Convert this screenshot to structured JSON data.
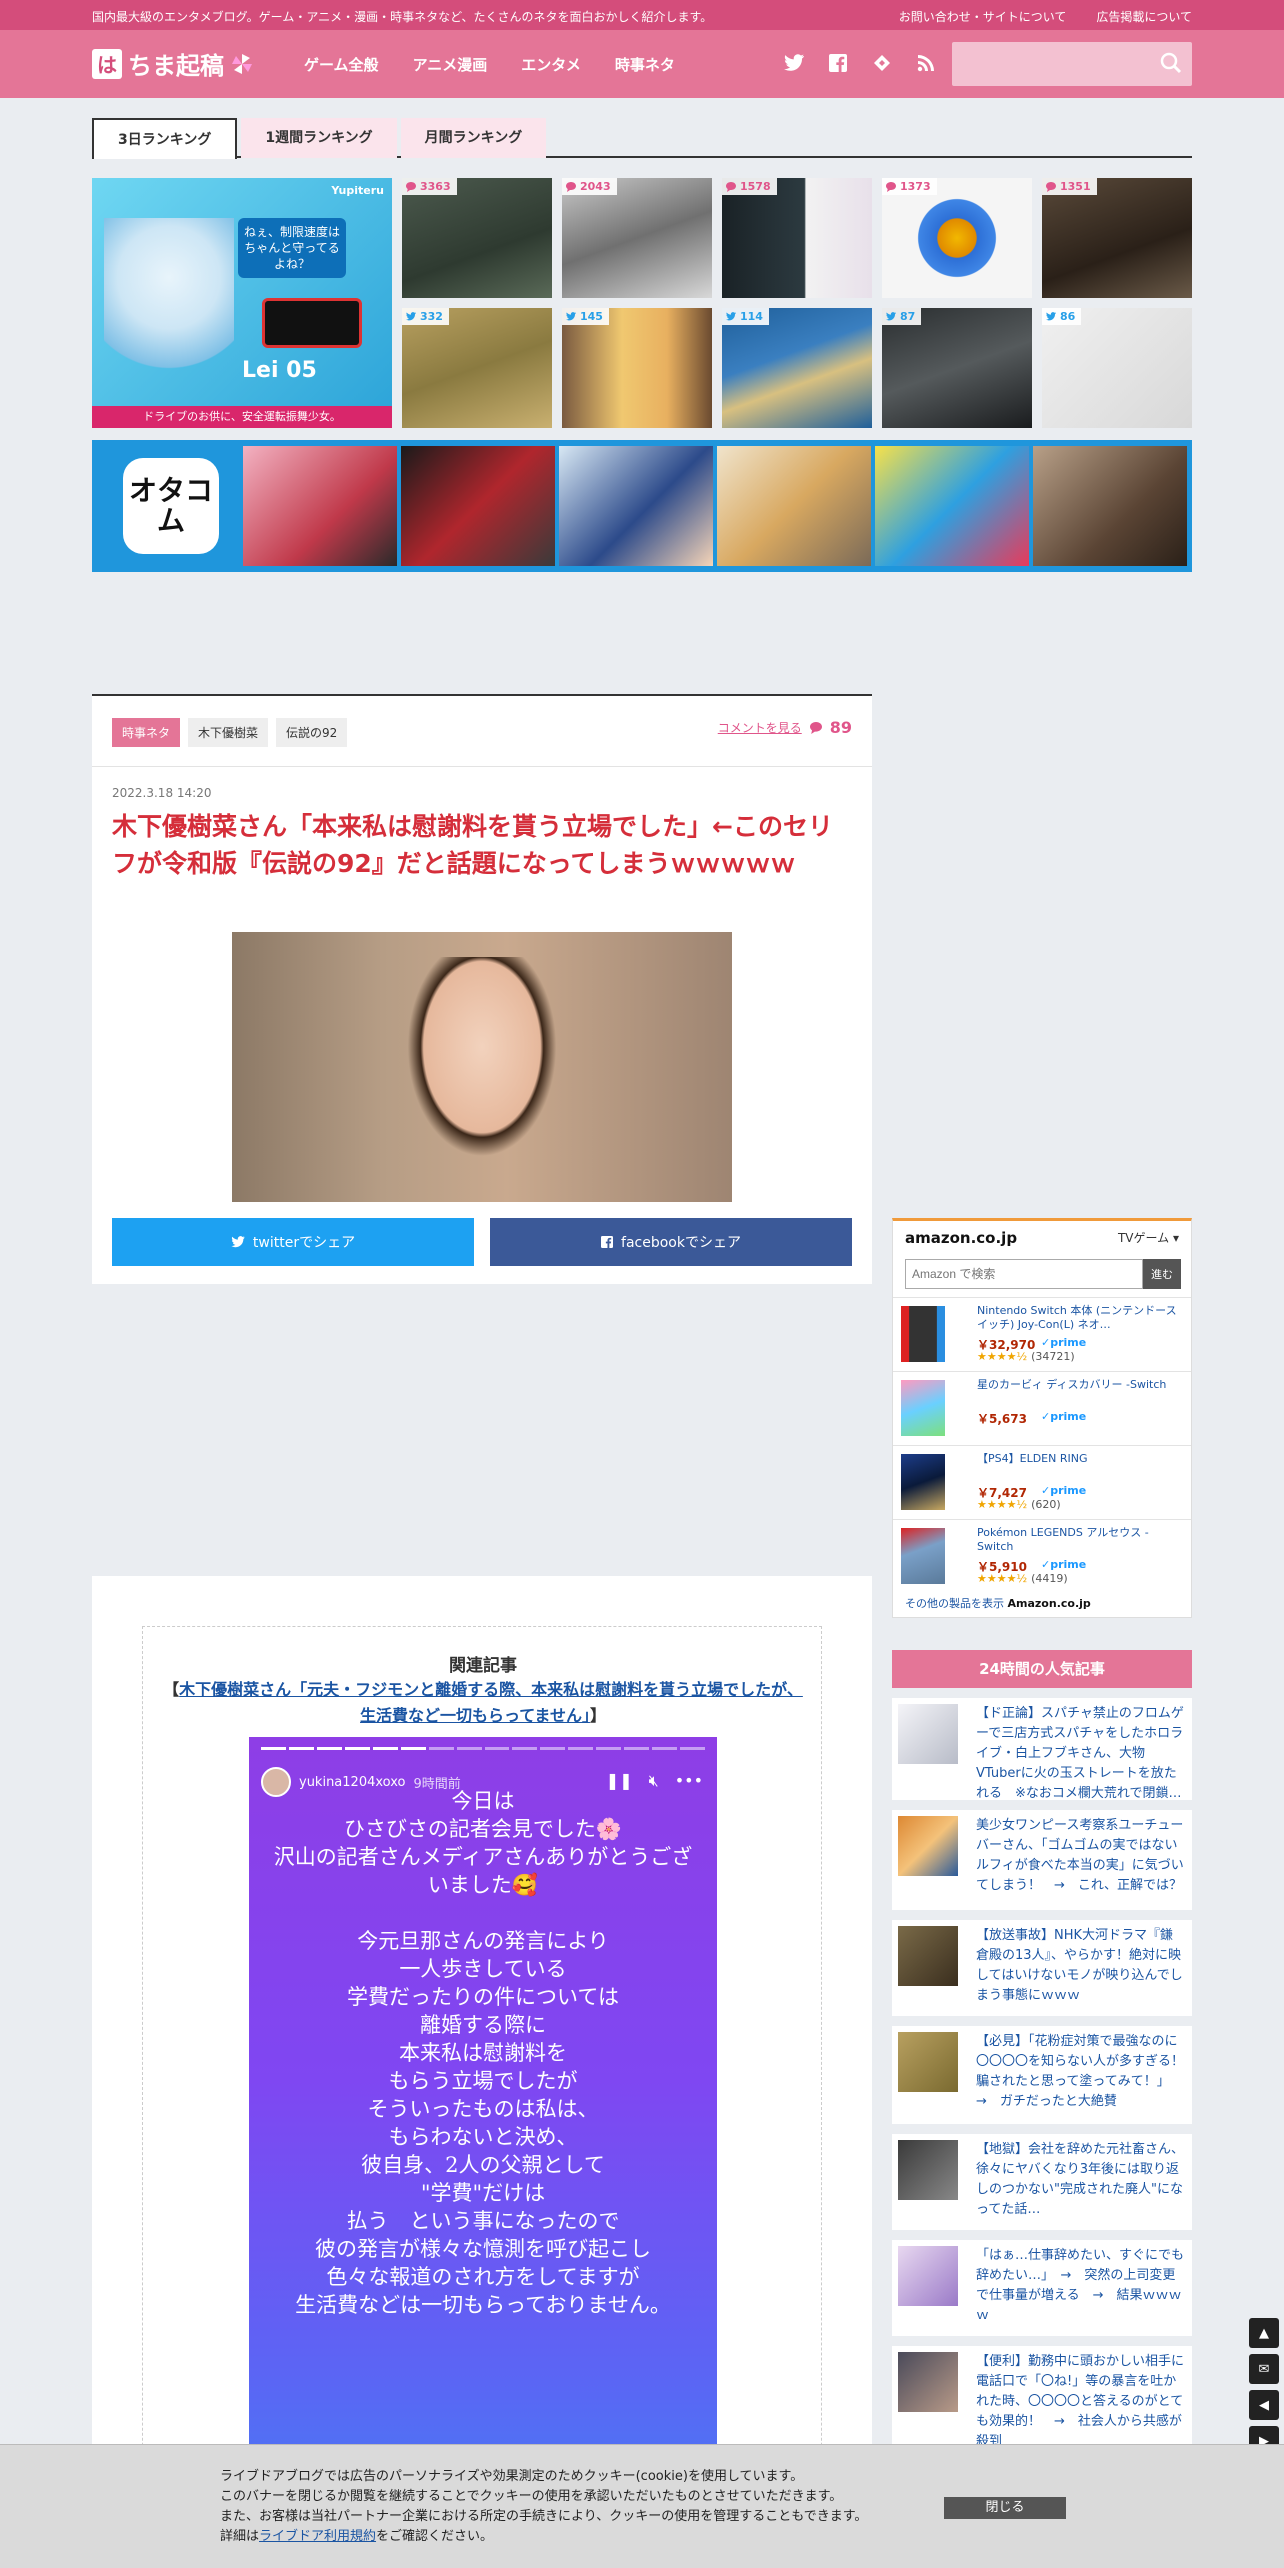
{
  "topbar": {
    "tagline": "国内最大級のエンタメブログ。ゲーム・アニメ・漫画・時事ネタなど、たくさんのネタを面白おかしく紹介します。",
    "contact": "お問い合わせ・サイトについて",
    "ads": "広告掲載について"
  },
  "header": {
    "logo_mark": "は",
    "logo_text": "ちま起稿",
    "nav": [
      "ゲーム全般",
      "アニメ漫画",
      "エンタメ",
      "時事ネタ"
    ],
    "search_placeholder": ""
  },
  "ranking_tabs": [
    "3日ランキング",
    "1週間ランキング",
    "月間ランキング"
  ],
  "ad_yupiteru": {
    "brand": "Yupiteru",
    "bubble": "ねぇ、制限速度はちゃんと守ってるよね？",
    "model": "Lei 05",
    "footer": "ドライブのお供に、安全運転振舞少女。"
  },
  "ranking_counts": [
    {
      "type": "comment",
      "count": "3363"
    },
    {
      "type": "comment",
      "count": "2043"
    },
    {
      "type": "comment",
      "count": "1578"
    },
    {
      "type": "comment",
      "count": "1373"
    },
    {
      "type": "comment",
      "count": "1351"
    },
    {
      "type": "twitter",
      "count": "332"
    },
    {
      "type": "twitter",
      "count": "145"
    },
    {
      "type": "twitter",
      "count": "114"
    },
    {
      "type": "twitter",
      "count": "87"
    },
    {
      "type": "twitter",
      "count": "86"
    }
  ],
  "ad_otacom": {
    "label": "オタコム"
  },
  "article": {
    "categories": [
      "時事ネタ",
      "木下優樹菜",
      "伝説の92"
    ],
    "comment_link": "コメントを見る",
    "comment_count": "89",
    "date": "2022.3.18 14:20",
    "title": "木下優樹菜さん「本来私は慰謝料を貰う立場でした」←このセリフが令和版『伝説の92』だと話題になってしまうｗｗｗｗｗ",
    "share_twitter": "twitterでシェア",
    "share_facebook": "facebookでシェア"
  },
  "related": {
    "heading": "関連記事",
    "open_bracket": "【",
    "link": "木下優樹菜さん「元夫・フジモンと離婚する際、本来私は慰謝料を貰う立場でしたが、生活費など一切もらってません」",
    "close_bracket": "】"
  },
  "story": {
    "username": "yukina1204xoxo",
    "time": "9時間前",
    "text": "今日は\nひさびさの記者会見でした🌸\n沢山の記者さんメディアさんありがとうございました🥰\n\n今元旦那さんの発言により\n一人歩きしている\n学費だったりの件については\n離婚する際に\n本来私は慰謝料を\nもらう立場でしたが\nそういったものは私は、\nもらわないと決め、\n彼自身、2人の父親として\n\"学費\"だけは\n払う　という事になったので\n彼の発言が様々な憶測を呼び起こし\n色々な報道のされ方をしてますが\n生活費などは一切もらっておりません。"
  },
  "amazon": {
    "logo": "amazon.co.jp",
    "category": "TVゲーム",
    "search_placeholder": "Amazon で検索",
    "go": "進む",
    "items": [
      {
        "name": "Nintendo Switch 本体 (ニンテンドースイッチ) Joy-Con(L) ネオ…",
        "price": "￥32,970",
        "prime": "✓prime",
        "stars": "★★★★½",
        "reviews": "(34721)"
      },
      {
        "name": "星のカービィ ディスカバリー -Switch",
        "price": "￥5,673",
        "prime": "✓prime",
        "stars": "",
        "reviews": ""
      },
      {
        "name": "【PS4】ELDEN RING",
        "price": "￥7,427",
        "prime": "✓prime",
        "stars": "★★★★½",
        "reviews": "(620)"
      },
      {
        "name": "Pokémon LEGENDS アルセウス -Switch",
        "price": "￥5,910",
        "prime": "✓prime",
        "stars": "★★★★½",
        "reviews": "(4419)"
      }
    ],
    "footer_text": "その他の製品を表示",
    "footer_brand": "Amazon.co.jp"
  },
  "popular": {
    "heading": "24時間の人気記事",
    "items": [
      "【ド正論】スパチャ禁止のフロムゲーで三店方式スパチャをしたホロライブ・白上フブキさん、大物VTuberに火の玉ストレートを放たれる　※なおコメ欄大荒れで閉鎖…",
      "美少女ワンピース考察系ユーチューバーさん、「ゴムゴムの実ではないルフィが食べた本当の実」に気づいてしまう！　→　これ、正解では？",
      "【放送事故】NHK大河ドラマ『鎌倉殿の13人』、やらかす！絶対に映してはいけないモノが映り込んでしまう事態にｗｗｗ",
      "【必見】「花粉症対策で最強なのに〇〇〇〇を知らない人が多すぎる！　騙されたと思って塗ってみて！」　→　ガチだったと大絶賛",
      "【地獄】会社を辞めた元社畜さん、徐々にヤバくなり3年後には取り返しのつかない\"完成された廃人\"になってた話…",
      "「はぁ…仕事辞めたい、すぐにでも辞めたい…」　→　突然の上司変更で仕事量が増える　→　結果ｗｗｗｗ",
      "【便利】勤務中に頭おかしい相手に電話口で「〇ね!」等の暴言を吐かれた時、〇〇〇〇と答えるのがとても効果的！　→　社会人から共感が殺到"
    ]
  },
  "floaters": [
    "top",
    "comment",
    "prev",
    "next"
  ],
  "cookie": {
    "line1": "ライブドアブログでは広告のパーソナライズや効果測定のためクッキー(cookie)を使用しています。",
    "line2": "このバナーを閉じるか閲覧を継続することでクッキーの使用を承認いただいたものとさせていただきます。",
    "line3": "また、お客様は当社パートナー企業における所定の手続きにより、クッキーの使用を管理することもできます。",
    "line4_prefix": "詳細は",
    "line4_link": "ライブドア利用規約",
    "line4_suffix": "をご確認ください。",
    "close": "閉じる"
  },
  "colors": {
    "brand": "#e47597",
    "topbar": "#d44d7b",
    "title_red": "#d52e3a",
    "twitter": "#1da1f2",
    "facebook": "#3b5998"
  }
}
